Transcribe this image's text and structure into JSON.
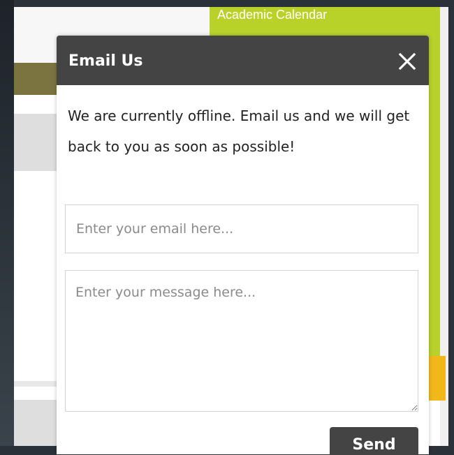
{
  "background": {
    "sidebar_link": "Academic Calendar"
  },
  "dialog": {
    "title": "Email Us",
    "close_icon": "close-icon",
    "message": "We are currently offline. Email us and we will get back to you as soon as possible!",
    "email_placeholder": "Enter your email here...",
    "message_placeholder": "Enter your message here...",
    "send_label": "Send"
  },
  "colors": {
    "header": "#444444",
    "sidebar_green": "#b9d22a",
    "olive": "#7b7440",
    "tab_yellow": "#f2b81a"
  }
}
